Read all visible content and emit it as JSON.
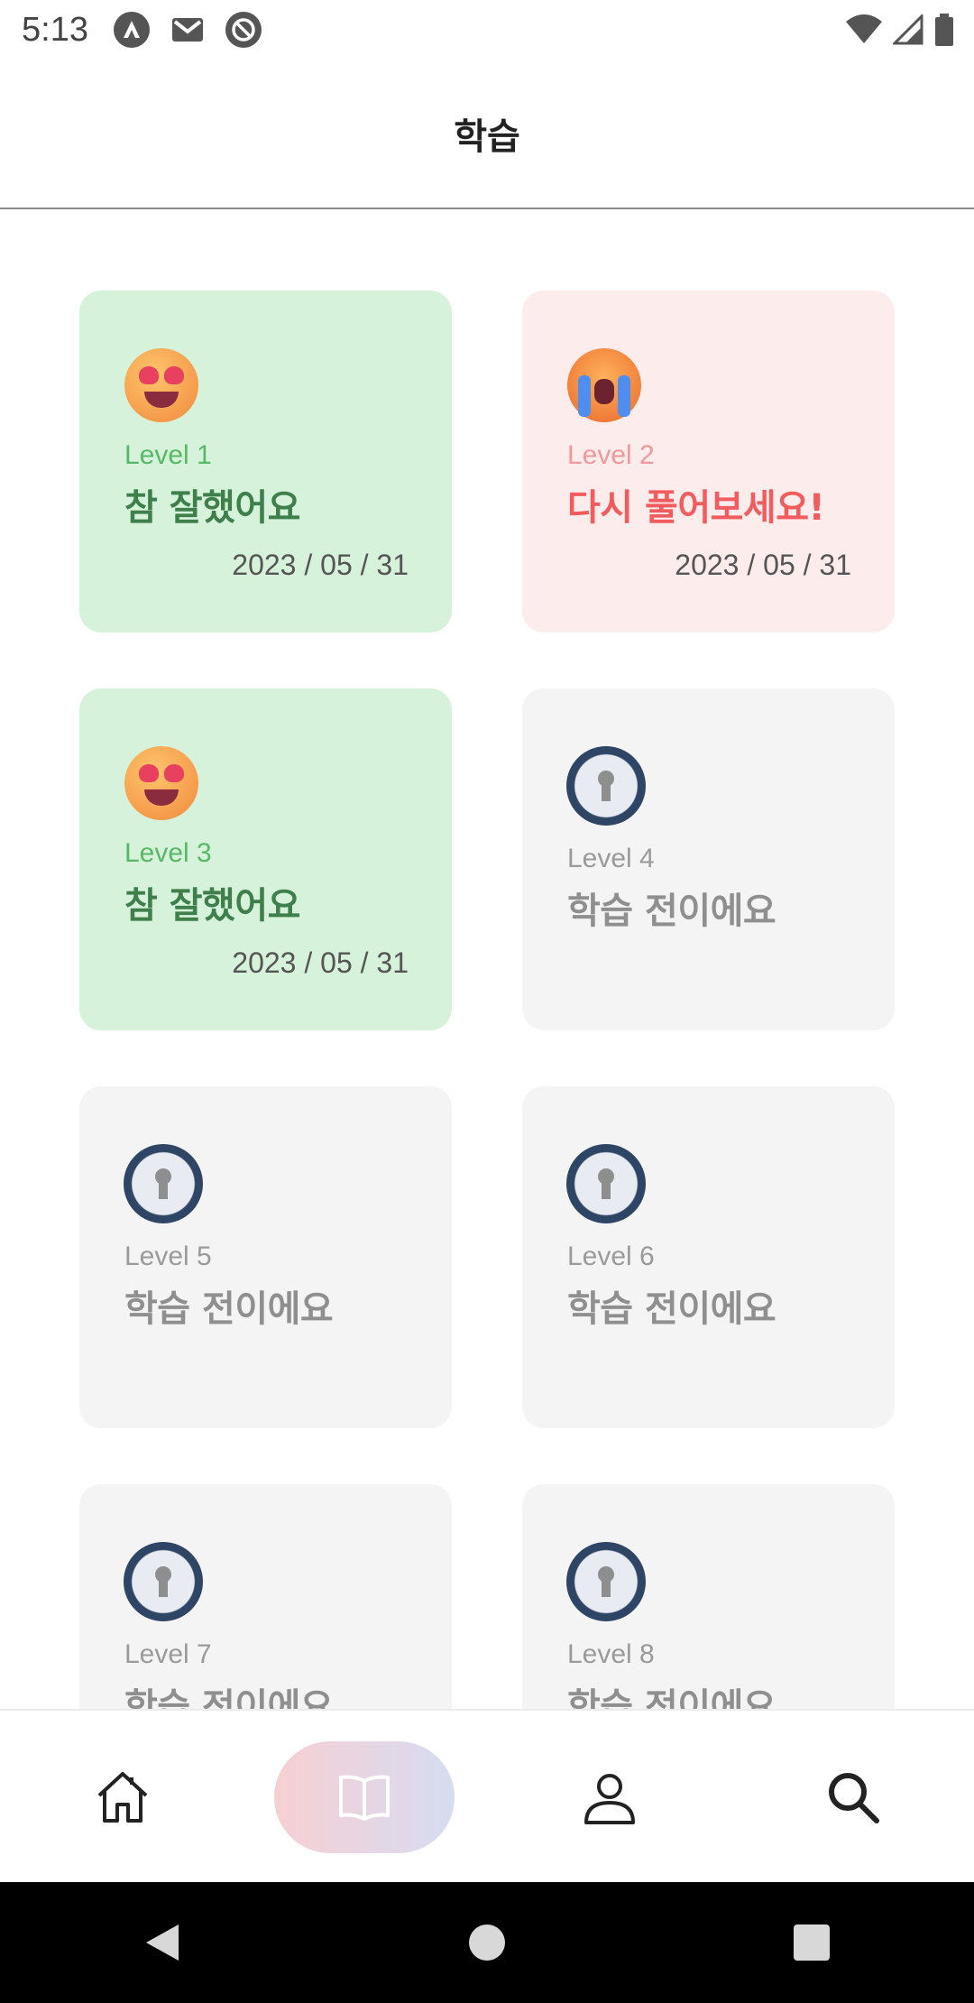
{
  "status_bar": {
    "time": "5:13",
    "left_icons": [
      "notification-a-icon",
      "gmail-icon",
      "at-sign-icon"
    ],
    "right_icons": [
      "wifi-icon",
      "cell-signal-icon",
      "battery-icon"
    ]
  },
  "app_bar": {
    "title": "학습"
  },
  "cards": [
    {
      "level": "Level 1",
      "label": "참 잘했어요",
      "date": "2023 / 05 / 31",
      "status": "success",
      "icon": "heart-eyes-emoji-icon"
    },
    {
      "level": "Level 2",
      "label": "다시 풀어보세요!",
      "date": "2023 / 05 / 31",
      "status": "retry",
      "icon": "crying-emoji-icon"
    },
    {
      "level": "Level 3",
      "label": "참 잘했어요",
      "date": "2023 / 05 / 31",
      "status": "success",
      "icon": "heart-eyes-emoji-icon"
    },
    {
      "level": "Level 4",
      "label": "학습 전이에요",
      "status": "locked",
      "icon": "lock-icon"
    },
    {
      "level": "Level 5",
      "label": "학습 전이에요",
      "status": "locked",
      "icon": "lock-icon"
    },
    {
      "level": "Level 6",
      "label": "학습 전이에요",
      "status": "locked",
      "icon": "lock-icon"
    },
    {
      "level": "Level 7",
      "label": "학습 전이에요",
      "status": "locked",
      "icon": "lock-icon"
    },
    {
      "level": "Level 8",
      "label": "학습 전이에요",
      "status": "locked",
      "icon": "lock-icon"
    }
  ],
  "bottom_nav": {
    "items": [
      {
        "icon": "home-icon",
        "active": false
      },
      {
        "icon": "book-icon",
        "active": true
      },
      {
        "icon": "profile-icon",
        "active": false
      },
      {
        "icon": "search-icon",
        "active": false
      }
    ]
  },
  "system_nav": [
    "back-icon",
    "home-circle-icon",
    "recents-icon"
  ],
  "colors": {
    "success_bg": "#d6f2da",
    "success_text": "#3e7f4c",
    "retry_bg": "#fdecec",
    "retry_text": "#f25c5e",
    "locked_bg": "#f4f4f4"
  }
}
